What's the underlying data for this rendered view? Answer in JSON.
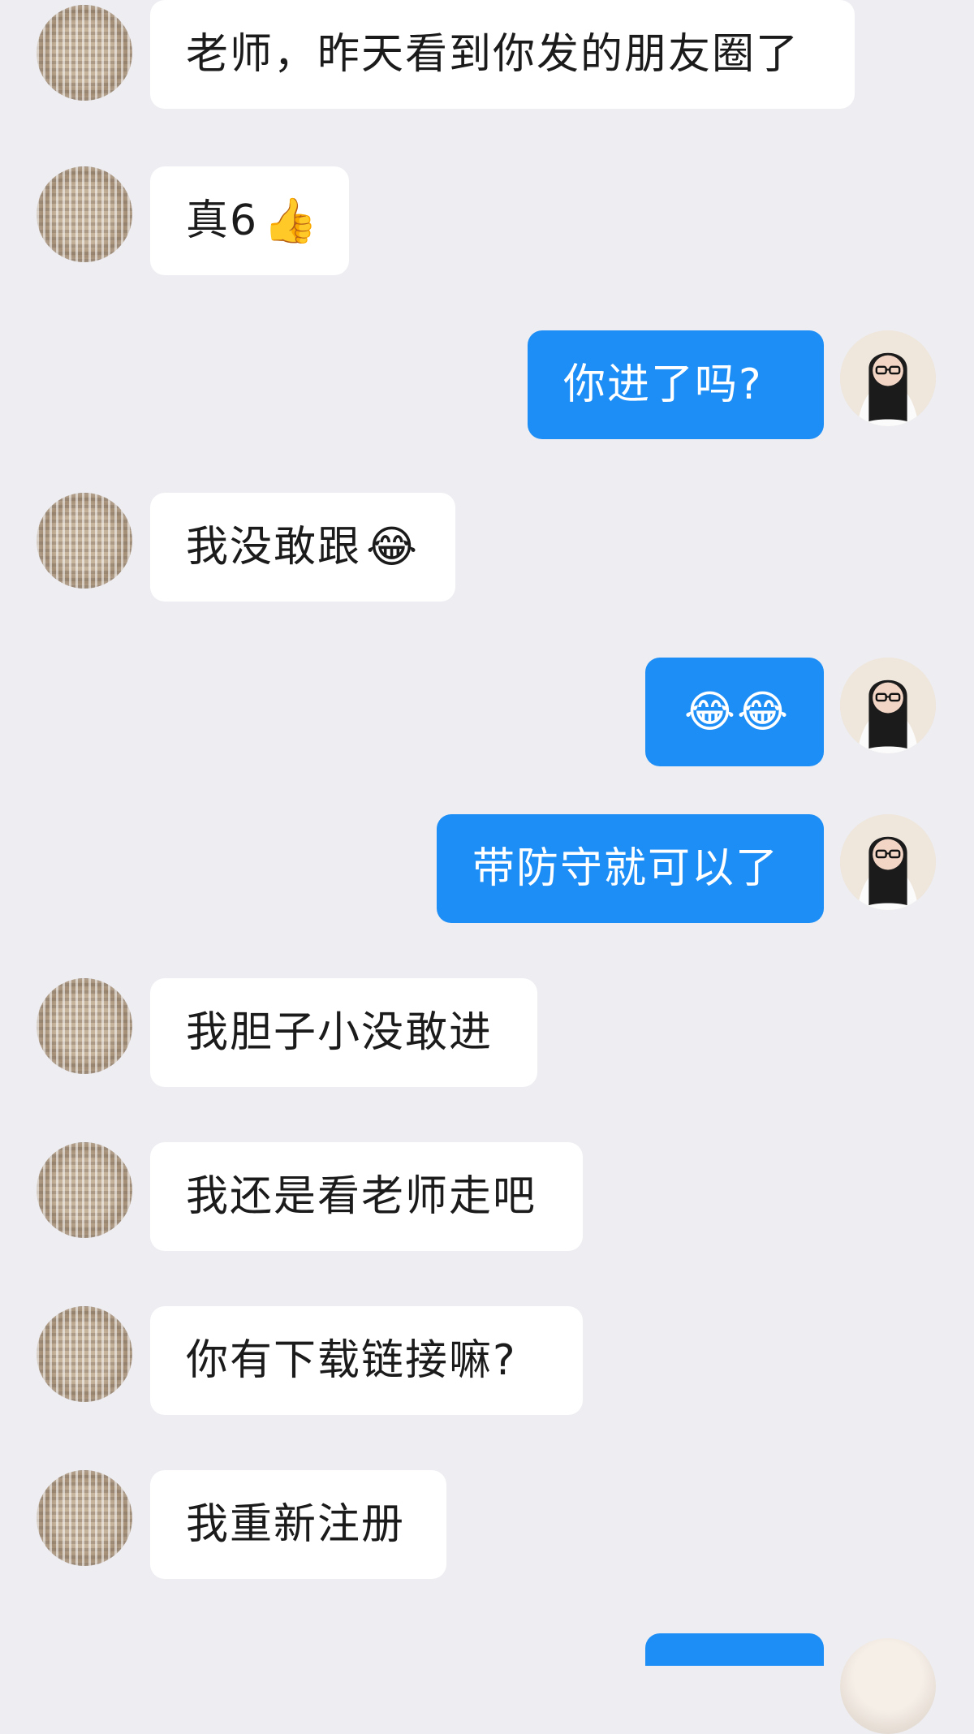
{
  "chat": {
    "messages": [
      {
        "side": "left",
        "text": "老师，昨天看到你发的朋友圈了",
        "emoji": ""
      },
      {
        "side": "left",
        "text": "真6",
        "emoji": "👍"
      },
      {
        "side": "right",
        "text": "你进了吗?",
        "emoji": ""
      },
      {
        "side": "left",
        "text": "我没敢跟",
        "emoji": "😂"
      },
      {
        "side": "right",
        "text": "",
        "emoji": "😂😂"
      },
      {
        "side": "right",
        "text": "带防守就可以了",
        "emoji": ""
      },
      {
        "side": "left",
        "text": "我胆子小没敢进",
        "emoji": ""
      },
      {
        "side": "left",
        "text": "我还是看老师走吧",
        "emoji": ""
      },
      {
        "side": "left",
        "text": "你有下载链接嘛?",
        "emoji": ""
      },
      {
        "side": "left",
        "text": "我重新注册",
        "emoji": ""
      }
    ]
  },
  "colors": {
    "background": "#EDEDF2",
    "left_bubble": "#FFFFFF",
    "right_bubble": "#1C8EF6",
    "left_text": "#1B1B1B",
    "right_text": "#FFFFFF"
  },
  "icons": {
    "left_avatar": "contact-avatar",
    "right_avatar": "user-avatar-girl-glasses"
  }
}
